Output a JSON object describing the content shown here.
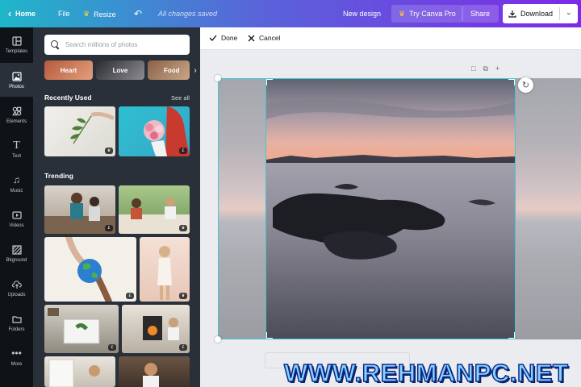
{
  "topbar": {
    "home_label": "Home",
    "file_label": "File",
    "resize_label": "Resize",
    "saved_status": "All changes saved",
    "new_design_label": "New design",
    "try_pro_label": "Try Canva Pro",
    "share_label": "Share",
    "download_label": "Download",
    "gradient_colors": [
      "#1fb6c9",
      "#5a63d9",
      "#7d2ae8"
    ]
  },
  "rail": {
    "items": [
      {
        "label": "Templates",
        "icon": "templates-icon"
      },
      {
        "label": "Photos",
        "icon": "photos-icon"
      },
      {
        "label": "Elements",
        "icon": "elements-icon"
      },
      {
        "label": "Text",
        "icon": "text-icon"
      },
      {
        "label": "Music",
        "icon": "music-icon"
      },
      {
        "label": "Videos",
        "icon": "videos-icon"
      },
      {
        "label": "Bkground",
        "icon": "background-icon"
      },
      {
        "label": "Uploads",
        "icon": "uploads-icon"
      },
      {
        "label": "Folders",
        "icon": "folders-icon"
      },
      {
        "label": "More",
        "icon": "more-icon"
      }
    ],
    "active_index": 1
  },
  "panel": {
    "search_placeholder": "Search millions of photos",
    "chips": [
      "Heart",
      "Love",
      "Food"
    ],
    "recently_used_title": "Recently Used",
    "see_all_label": "See all",
    "trending_title": "Trending",
    "badges": {
      "crown": "♛",
      "pound": "£"
    }
  },
  "edit_bar": {
    "done_label": "Done",
    "cancel_label": "Cancel"
  },
  "watermark": "WWW.REHMANPC.NET",
  "colors": {
    "selection": "#3fc8d4",
    "rail_bg": "#0e1318",
    "panel_bg": "#293039"
  }
}
